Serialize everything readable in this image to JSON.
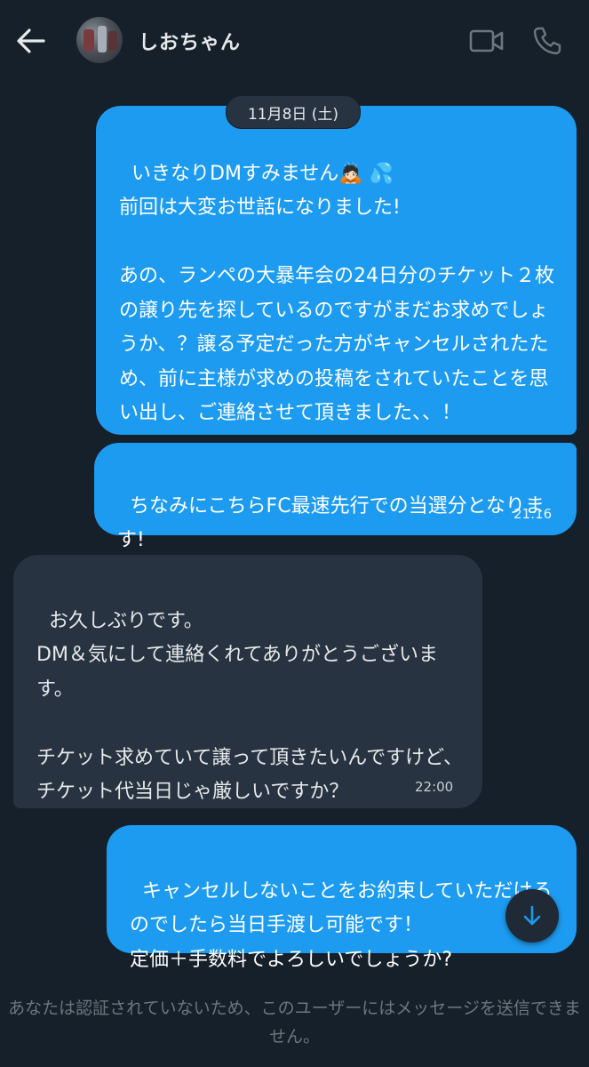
{
  "header": {
    "contact_name": "しおちゃん",
    "icons": [
      "back-arrow-icon",
      "avatar",
      "video-call-icon",
      "phone-icon"
    ]
  },
  "date_divider": "11月8日 (土)",
  "messages": [
    {
      "direction": "outgoing",
      "text": "いきなりDMすみません🙇🏻 💦\n前回は大変お世話になりました!\n\nあの、ランペの大暴年会の24日分のチケット２枚の譲り先を探しているのですがまだお求めでしょうか、？譲る予定だった方がキャンセルされたため、前に主様が求めの投稿をされていたことを思い出し、ご連絡させて頂きました、、！",
      "time": ""
    },
    {
      "direction": "outgoing",
      "text": "ちなみにこちらFC最速先行での当選分となります!",
      "time": "21:16"
    },
    {
      "direction": "incoming",
      "text": "お久しぶりです。\nDM＆気にして連絡くれてありがとうございます。\n\nチケット求めていて譲って頂きたいんですけど、チケット代当日じゃ厳しいですか？",
      "time": "22:00"
    },
    {
      "direction": "outgoing",
      "text": "キャンセルしないことをお約束していただけるのでしたら当日手渡し可能です！\n定価＋手数料でよろしいでしょうか?",
      "time": ""
    }
  ],
  "footer_note": "あなたは認証されていないため、このユーザーにはメッセージを送信できません。",
  "colors": {
    "background": "#15202b",
    "outgoing_bubble": "#1d9bf0",
    "incoming_bubble": "#273340",
    "muted_text": "#6e767d"
  }
}
